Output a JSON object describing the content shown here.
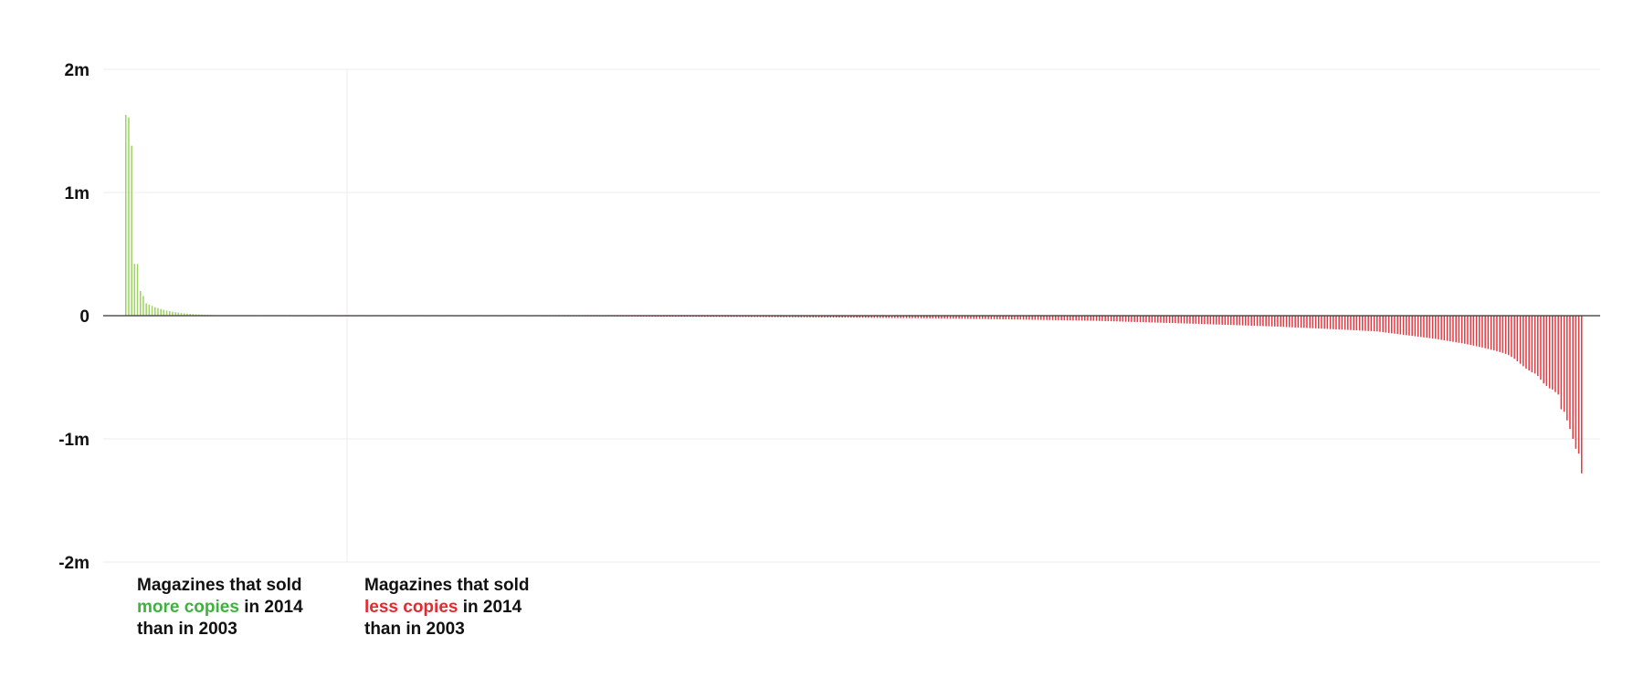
{
  "colors": {
    "gain": "#9ed35f",
    "loss": "#e8373f",
    "gain_text": "#3cb43c",
    "loss_text": "#e8282f",
    "grid": "#ececec",
    "zero_line": "#333333"
  },
  "chart_data": {
    "type": "bar",
    "title": "",
    "xlabel": "",
    "ylabel": "",
    "ylim": [
      -2000000,
      2000000
    ],
    "yticks": [
      {
        "value": 2000000,
        "label": "2m"
      },
      {
        "value": 1000000,
        "label": "1m"
      },
      {
        "value": 0,
        "label": "0"
      },
      {
        "value": -1000000,
        "label": "-1m"
      },
      {
        "value": -2000000,
        "label": "-2m"
      }
    ],
    "grid": true,
    "series": [
      {
        "values": [
          1630000,
          1610000,
          1380000,
          420000,
          420000,
          200000,
          160000,
          100000,
          90000,
          80000,
          70000,
          62000,
          55000,
          48000,
          42000,
          37000,
          32000,
          28000,
          25000,
          22000,
          19000,
          17000,
          15000,
          13000,
          11500,
          10000,
          9000,
          8000,
          7000,
          6200,
          5500,
          4800,
          4200,
          3700,
          3200,
          2800,
          2400,
          2100,
          1800,
          1500,
          1300,
          1100,
          900,
          750,
          600,
          450,
          300,
          150
        ]
      },
      {
        "values": [
          -1000,
          -1040,
          -1080,
          -1120,
          -1160,
          -1200,
          -1240,
          -1280,
          -1320,
          -1360,
          -1400,
          -1440,
          -1480,
          -1520,
          -1560,
          -1600,
          -1640,
          -1680,
          -1720,
          -1760,
          -1800,
          -1840,
          -1880,
          -1920,
          -1960,
          -2000,
          -2040,
          -2080,
          -2120,
          -2160,
          -2200,
          -2240,
          -2280,
          -2320,
          -2360,
          -2400,
          -2440,
          -2480,
          -2520,
          -2560,
          -2600,
          -2640,
          -2680,
          -2720,
          -2760,
          -2800,
          -2840,
          -2880,
          -2920,
          -2960,
          -3000,
          -3040,
          -3080,
          -3120,
          -3160,
          -3200,
          -3240,
          -3280,
          -3320,
          -3360,
          -3400,
          -3440,
          -3480,
          -3520,
          -3560,
          -3600,
          -3640,
          -3680,
          -3720,
          -3760,
          -3800,
          -3840,
          -3880,
          -3920,
          -3960,
          -4000,
          -4050,
          -4100,
          -4150,
          -4200,
          -4250,
          -4300,
          -4350,
          -4400,
          -4450,
          -4500,
          -4550,
          -4600,
          -4650,
          -4700,
          -4750,
          -4800,
          -4850,
          -4900,
          -4950,
          -5000,
          -5070,
          -5140,
          -5210,
          -5280,
          -5350,
          -5420,
          -5490,
          -5560,
          -5630,
          -5700,
          -5770,
          -5840,
          -5910,
          -5980,
          -6050,
          -6120,
          -6190,
          -6260,
          -6330,
          -6400,
          -6470,
          -6540,
          -6610,
          -6680,
          -6750,
          -6820,
          -6890,
          -6960,
          -7030,
          -7100,
          -7200,
          -7300,
          -7400,
          -7500,
          -7600,
          -7700,
          -7800,
          -7900,
          -8000,
          -8100,
          -8200,
          -8300,
          -8400,
          -8500,
          -8600,
          -8700,
          -8800,
          -8900,
          -9000,
          -9100,
          -9200,
          -9300,
          -9400,
          -9500,
          -9600,
          -9700,
          -9800,
          -9900,
          -10000,
          -10100,
          -10250,
          -10400,
          -10550,
          -10700,
          -10850,
          -11000,
          -11150,
          -11300,
          -11450,
          -11600,
          -11750,
          -11900,
          -12050,
          -12200,
          -12350,
          -12500,
          -12650,
          -12800,
          -12950,
          -13100,
          -13250,
          -13400,
          -13550,
          -13700,
          -13850,
          -14000,
          -14150,
          -14300,
          -14450,
          -14600,
          -14800,
          -15000,
          -15200,
          -15400,
          -15600,
          -15800,
          -16000,
          -16200,
          -16400,
          -16600,
          -16800,
          -17000,
          -17200,
          -17400,
          -17600,
          -17800,
          -18000,
          -18200,
          -18400,
          -18600,
          -18800,
          -19000,
          -19200,
          -19400,
          -19600,
          -19800,
          -20000,
          -20200,
          -20400,
          -20600,
          -20800,
          -21100,
          -21400,
          -21700,
          -22000,
          -22300,
          -22600,
          -22900,
          -23200,
          -23500,
          -23800,
          -24100,
          -24400,
          -24700,
          -25000,
          -25300,
          -25600,
          -25900,
          -26200,
          -26500,
          -26800,
          -27100,
          -27400,
          -27700,
          -28000,
          -28300,
          -28600,
          -28900,
          -29200,
          -29500,
          -29800,
          -30200,
          -30600,
          -31000,
          -31400,
          -31800,
          -32200,
          -32600,
          -33000,
          -33400,
          -33800,
          -34200,
          -34600,
          -35000,
          -35400,
          -35800,
          -36200,
          -36600,
          -37000,
          -37400,
          -37800,
          -38200,
          -38600,
          -39000,
          -39400,
          -39800,
          -40200,
          -40600,
          -41000,
          -41400,
          -41800,
          -42500,
          -43200,
          -43900,
          -44600,
          -45300,
          -46000,
          -46700,
          -47400,
          -48100,
          -48800,
          -49500,
          -50200,
          -50900,
          -51600,
          -52300,
          -53000,
          -53700,
          -54400,
          -55100,
          -55800,
          -56500,
          -57200,
          -57900,
          -58600,
          -59300,
          -60000,
          -60700,
          -61400,
          -62100,
          -62800,
          -63500,
          -64300,
          -65100,
          -65900,
          -66700,
          -67500,
          -68300,
          -69100,
          -69900,
          -70700,
          -71500,
          -72300,
          -73100,
          -73900,
          -74700,
          -75500,
          -76300,
          -77100,
          -77900,
          -78700,
          -79500,
          -80300,
          -81100,
          -81900,
          -82700,
          -83500,
          -84300,
          -85100,
          -85900,
          -86700,
          -87500,
          -88600,
          -89700,
          -90800,
          -91900,
          -93000,
          -94100,
          -95200,
          -96300,
          -97400,
          -98500,
          -99600,
          -100700,
          -101800,
          -102900,
          -104000,
          -105100,
          -106200,
          -107300,
          -108400,
          -109500,
          -110600,
          -111700,
          -112800,
          -113900,
          -115000,
          -116300,
          -117600,
          -118900,
          -120200,
          -121500,
          -122800,
          -124100,
          -125400,
          -126700,
          -128000,
          -131000,
          -134000,
          -137000,
          -140000,
          -143000,
          -146000,
          -149000,
          -152000,
          -155000,
          -158000,
          -161000,
          -164000,
          -167000,
          -170000,
          -173000,
          -176000,
          -179000,
          -182000,
          -185000,
          -188000,
          -192000,
          -196000,
          -200000,
          -204000,
          -208000,
          -212000,
          -216000,
          -220000,
          -224000,
          -228000,
          -233000,
          -238000,
          -243000,
          -248000,
          -253000,
          -258000,
          -264000,
          -270000,
          -276000,
          -282000,
          -288000,
          -295000,
          -302000,
          -310000,
          -320000,
          -335000,
          -350000,
          -370000,
          -390000,
          -410000,
          -430000,
          -445000,
          -460000,
          -470000,
          -490000,
          -520000,
          -550000,
          -570000,
          -590000,
          -600000,
          -620000,
          -640000,
          -760000,
          -780000,
          -850000,
          -920000,
          -1000000,
          -1080000,
          -1120000,
          -1280000
        ]
      }
    ]
  },
  "annotations": {
    "gain": {
      "line1": "Magazines that sold",
      "highlight": "more copies",
      "rest": " in 2014",
      "line3": "than in 2003"
    },
    "loss": {
      "line1": "Magazines that sold",
      "highlight": "less copies",
      "rest": " in 2014",
      "line3": "than in 2003"
    }
  }
}
